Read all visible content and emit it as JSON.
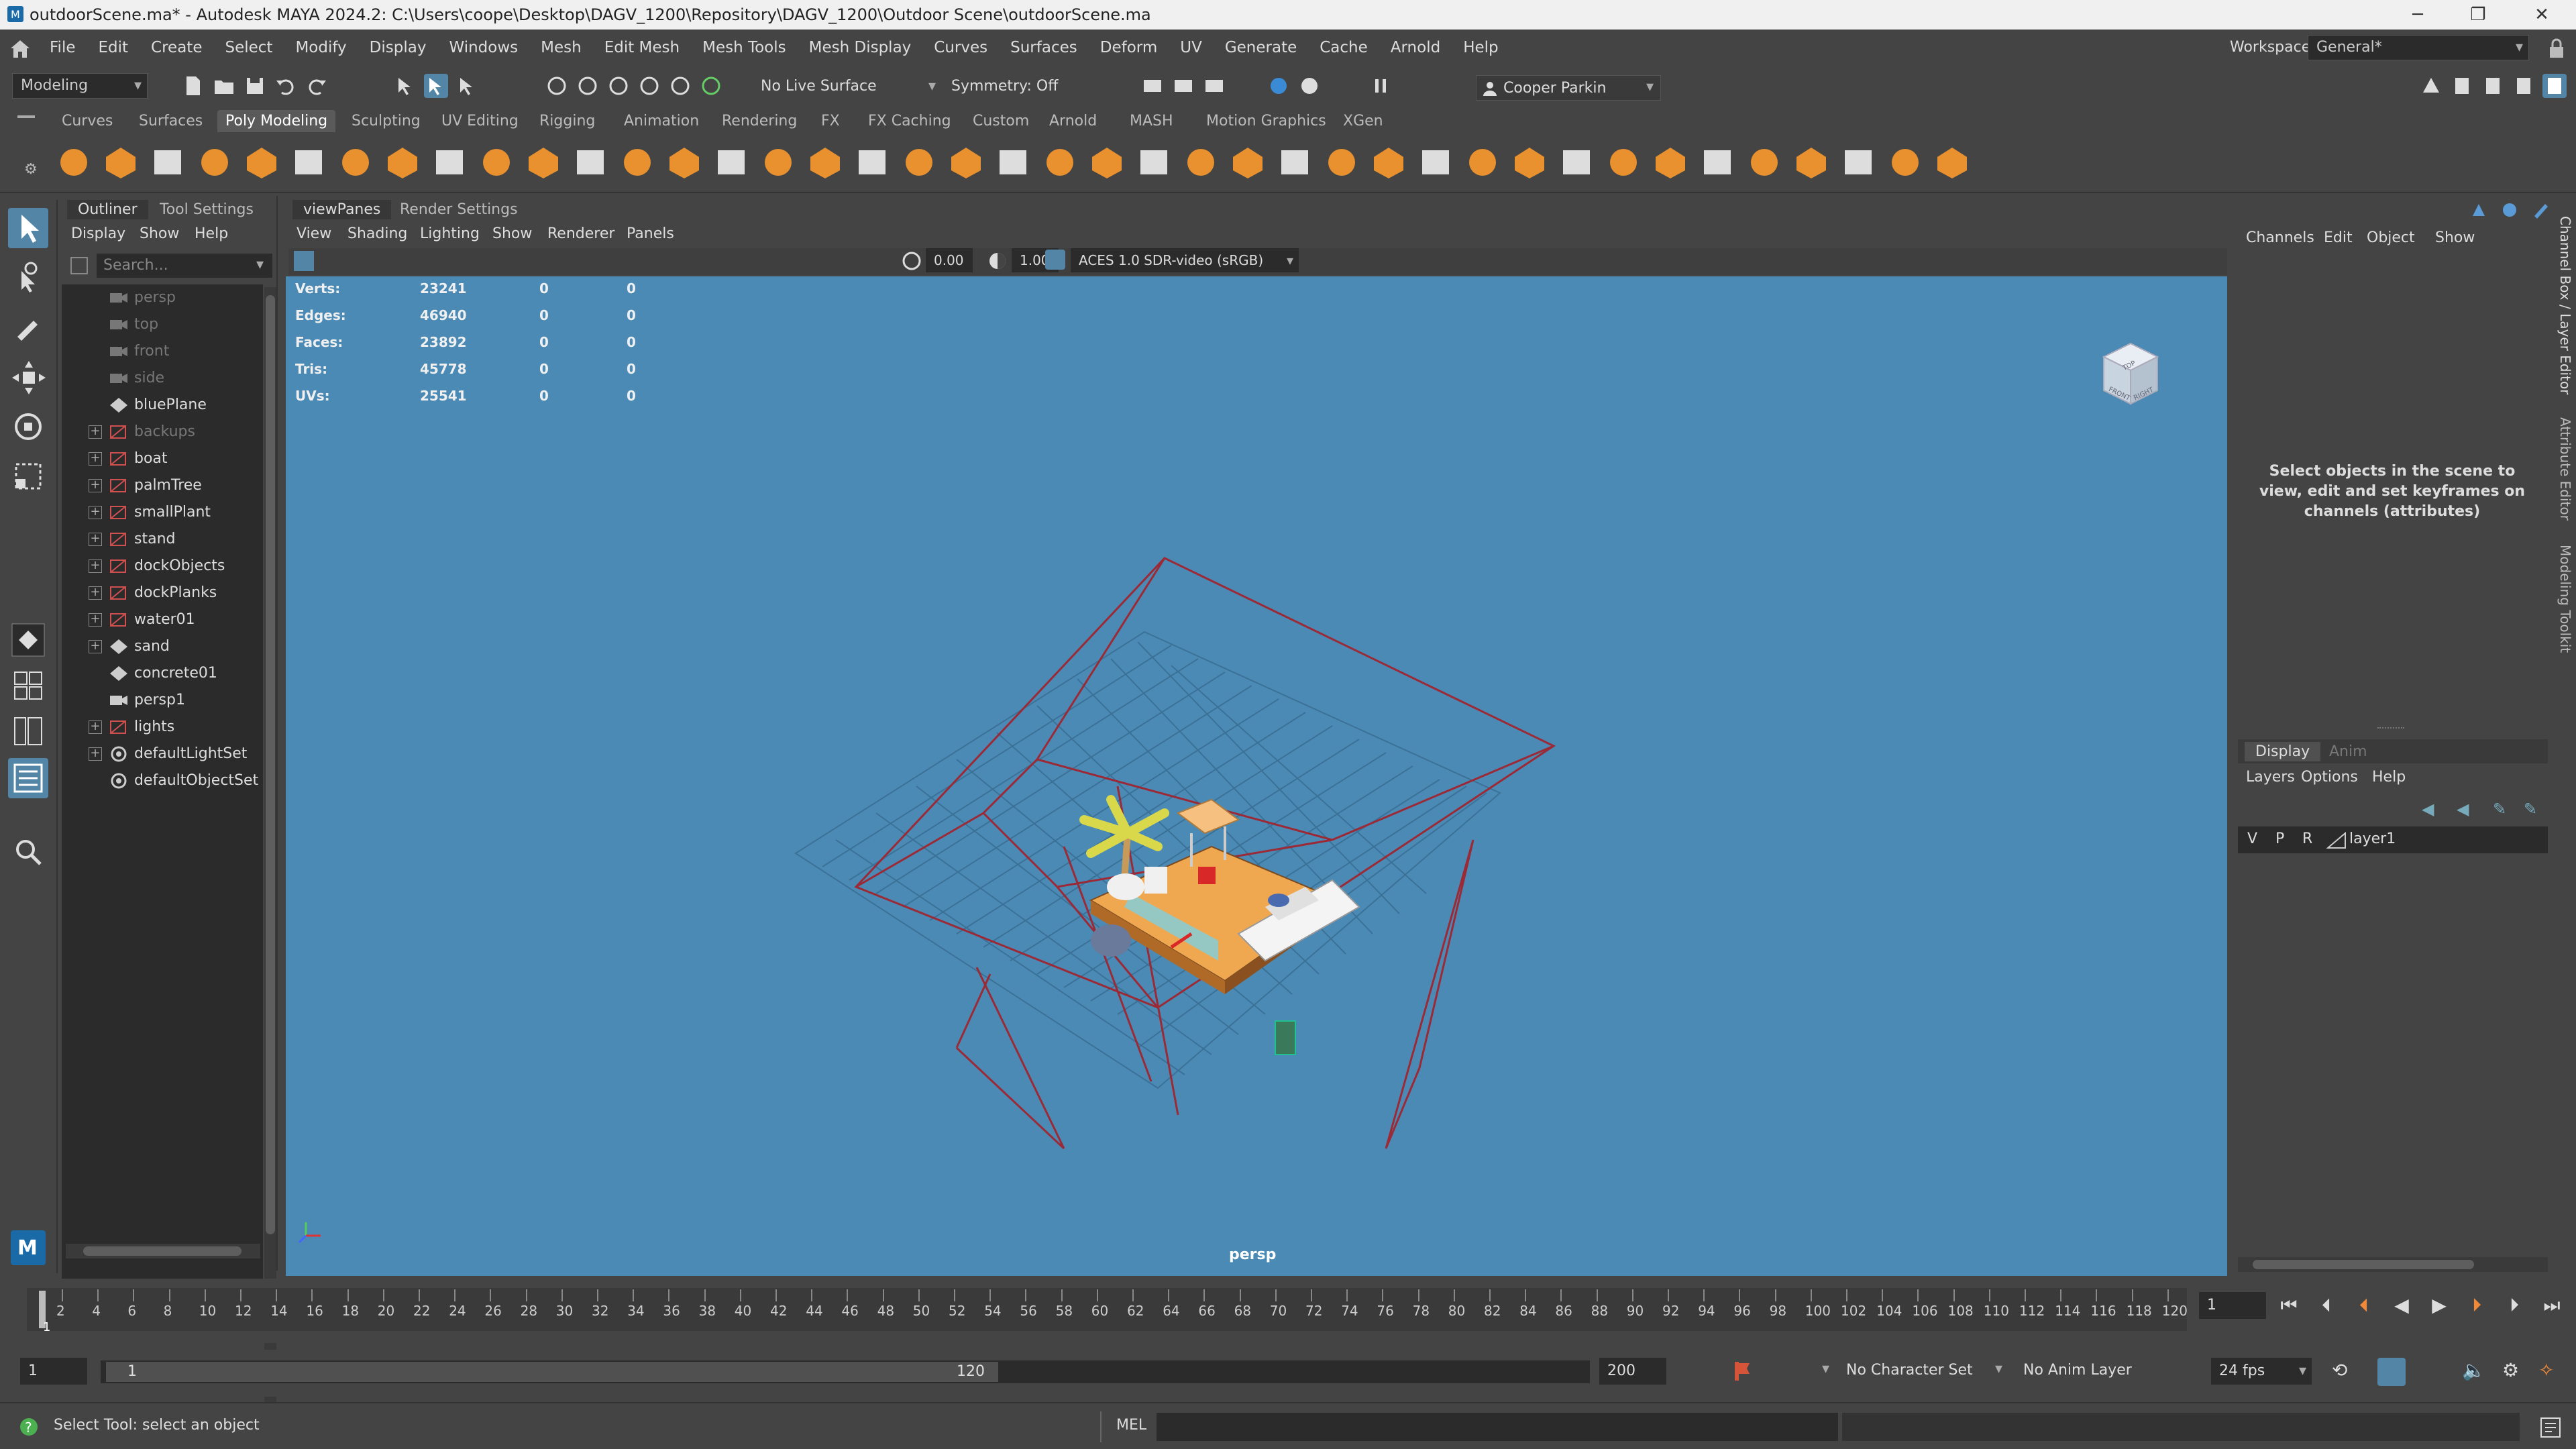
{
  "titlebar": {
    "title": "outdoorScene.ma* - Autodesk MAYA 2024.2: C:\\Users\\coope\\Desktop\\DAGV_1200\\Repository\\DAGV_1200\\Outdoor Scene\\outdoorScene.ma",
    "minimize": "─",
    "restore": "❐",
    "close": "✕"
  },
  "menubar": {
    "items": [
      "File",
      "Edit",
      "Create",
      "Select",
      "Modify",
      "Display",
      "Windows",
      "Mesh",
      "Edit Mesh",
      "Mesh Tools",
      "Mesh Display",
      "Curves",
      "Surfaces",
      "Deform",
      "UV",
      "Generate",
      "Cache",
      "Arnold",
      "Help"
    ],
    "workspace_label": "Workspace:",
    "workspace_value": "General*"
  },
  "statusline": {
    "menuset": "Modeling",
    "live_surface": "No Live Surface",
    "symmetry": "Symmetry: Off",
    "user": "Cooper Parkin"
  },
  "shelf": {
    "tabs": [
      "Curves",
      "Surfaces",
      "Poly Modeling",
      "Sculpting",
      "UV Editing",
      "Rigging",
      "Animation",
      "Rendering",
      "FX",
      "FX Caching",
      "Custom",
      "Arnold",
      "MASH",
      "Motion Graphics",
      "XGen"
    ],
    "active_tab": "Poly Modeling"
  },
  "outliner": {
    "tabs": [
      "Outliner",
      "Tool Settings"
    ],
    "menu": [
      "Display",
      "Show",
      "Help"
    ],
    "search_placeholder": "Search...",
    "items": [
      {
        "label": "persp",
        "type": "camera",
        "dim": true,
        "expandable": false
      },
      {
        "label": "top",
        "type": "camera",
        "dim": true,
        "expandable": false
      },
      {
        "label": "front",
        "type": "camera",
        "dim": true,
        "expandable": false
      },
      {
        "label": "side",
        "type": "camera",
        "dim": true,
        "expandable": false
      },
      {
        "label": "bluePlane",
        "type": "mesh",
        "dim": false,
        "expandable": false
      },
      {
        "label": "backups",
        "type": "group",
        "dim": true,
        "expandable": true
      },
      {
        "label": "boat",
        "type": "group",
        "dim": false,
        "expandable": true
      },
      {
        "label": "palmTree",
        "type": "group",
        "dim": false,
        "expandable": true
      },
      {
        "label": "smallPlant",
        "type": "group",
        "dim": false,
        "expandable": true
      },
      {
        "label": "stand",
        "type": "group",
        "dim": false,
        "expandable": true
      },
      {
        "label": "dockObjects",
        "type": "group",
        "dim": false,
        "expandable": true
      },
      {
        "label": "dockPlanks",
        "type": "group",
        "dim": false,
        "expandable": true
      },
      {
        "label": "water01",
        "type": "group",
        "dim": false,
        "expandable": true
      },
      {
        "label": "sand",
        "type": "mesh",
        "dim": false,
        "expandable": true
      },
      {
        "label": "concrete01",
        "type": "mesh",
        "dim": false,
        "expandable": false
      },
      {
        "label": "persp1",
        "type": "camera",
        "dim": false,
        "expandable": false
      },
      {
        "label": "lights",
        "type": "group",
        "dim": false,
        "expandable": true
      },
      {
        "label": "defaultLightSet",
        "type": "set",
        "dim": false,
        "expandable": true
      },
      {
        "label": "defaultObjectSet",
        "type": "set",
        "dim": false,
        "expandable": false
      }
    ]
  },
  "viewpanel": {
    "tabs": [
      "viewPanes",
      "Render Settings"
    ],
    "menu": [
      "View",
      "Shading",
      "Lighting",
      "Show",
      "Renderer",
      "Panels"
    ],
    "exposure": "0.00",
    "gamma": "1.00",
    "colorspace": "ACES 1.0 SDR-video (sRGB)",
    "camera_label": "persp",
    "hud": {
      "rows": [
        {
          "label": "Verts:",
          "v1": "23241",
          "v2": "0",
          "v3": "0"
        },
        {
          "label": "Edges:",
          "v1": "46940",
          "v2": "0",
          "v3": "0"
        },
        {
          "label": "Faces:",
          "v1": "23892",
          "v2": "0",
          "v3": "0"
        },
        {
          "label": "Tris:",
          "v1": "45778",
          "v2": "0",
          "v3": "0"
        },
        {
          "label": "UVs:",
          "v1": "25541",
          "v2": "0",
          "v3": "0"
        }
      ]
    },
    "viewcube": {
      "top": "TOP",
      "front": "FRONT",
      "right": "RIGHT"
    }
  },
  "channelbox": {
    "menu": [
      "Channels",
      "Edit",
      "Object",
      "Show"
    ],
    "message": "Select objects in the scene to view, edit and set keyframes on channels (attributes)",
    "layer_tabs": [
      "Display",
      "Anim"
    ],
    "layer_menu": [
      "Layers",
      "Options",
      "Help"
    ],
    "layer": {
      "v": "V",
      "p": "P",
      "r": "R",
      "name": "layer1"
    },
    "side_tabs": [
      "Channel Box / Layer Editor",
      "Attribute Editor",
      "Modeling Toolkit"
    ]
  },
  "timeline": {
    "ticks": [
      "2",
      "4",
      "6",
      "8",
      "10",
      "12",
      "14",
      "16",
      "18",
      "20",
      "22",
      "24",
      "26",
      "28",
      "30",
      "32",
      "34",
      "36",
      "38",
      "40",
      "42",
      "44",
      "46",
      "48",
      "50",
      "52",
      "54",
      "56",
      "58",
      "60",
      "62",
      "64",
      "66",
      "68",
      "70",
      "72",
      "74",
      "76",
      "78",
      "80",
      "82",
      "84",
      "86",
      "88",
      "90",
      "92",
      "94",
      "96",
      "98",
      "100",
      "102",
      "104",
      "106",
      "108",
      "110",
      "112",
      "114",
      "116",
      "118",
      "120"
    ],
    "current_frame_marker": "1",
    "current_frame": "1"
  },
  "range": {
    "start": "1",
    "range_start": "1",
    "range_end": "120",
    "end": "200",
    "character_set": "No Character Set",
    "anim_layer": "No Anim Layer",
    "fps": "24 fps"
  },
  "helpline": {
    "text": "Select Tool: select an object",
    "mel_label": "MEL"
  },
  "colors": {
    "viewport_bg": "#4a8ab5",
    "ui_bg": "#444444",
    "panel_dark": "#2b2b2b",
    "shelf_icon_orange": "#e8912e",
    "camera_frustum": "#9b2a36"
  }
}
